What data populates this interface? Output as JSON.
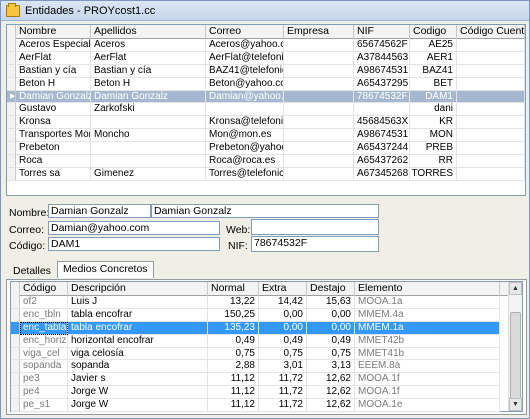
{
  "window": {
    "title": "Entidades - PROYcost1.cc",
    "icon": "folder-icon"
  },
  "entities": {
    "columns": [
      "Nombre",
      "Apellidos",
      "Correo",
      "Empresa",
      "NIF",
      "Codigo",
      "Código Cuenta"
    ],
    "rows": [
      {
        "nombre": "Aceros Especiales",
        "apellidos": "Aceros",
        "correo": "Aceros@yahoo.com",
        "empresa": "",
        "nif": "65674562F",
        "codigo": "AE25",
        "cuenta": "",
        "state": ""
      },
      {
        "nombre": "AerFlat",
        "apellidos": "AerFlat",
        "correo": "AerFlat@telefonica.e",
        "empresa": "",
        "nif": "A37844563",
        "codigo": "AER1",
        "cuenta": "",
        "state": ""
      },
      {
        "nombre": "Bastian y cía",
        "apellidos": "Bastian y cía",
        "correo": "BAZ41@telefonica.e",
        "empresa": "",
        "nif": "A98674531",
        "codigo": "BAZ41",
        "cuenta": "",
        "state": ""
      },
      {
        "nombre": "Beton H",
        "apellidos": "Beton H",
        "correo": "Beton@yahoo.com",
        "empresa": "",
        "nif": "A65437295",
        "codigo": "BET",
        "cuenta": "",
        "state": ""
      },
      {
        "nombre": "Damian Gonzalz",
        "apellidos": "Damian Gonzalz",
        "correo": "Damian@yahoo.com",
        "empresa": "",
        "nif": "78674532F",
        "codigo": "DAM1",
        "cuenta": "",
        "state": "selected"
      },
      {
        "nombre": "Gustavo",
        "apellidos": "Zarkofski",
        "correo": "",
        "empresa": "",
        "nif": "",
        "codigo": "dani",
        "cuenta": "",
        "state": ""
      },
      {
        "nombre": "Kronsa",
        "apellidos": "",
        "correo": "Kronsa@telefonica.r",
        "empresa": "",
        "nif": "45684563X",
        "codigo": "KR",
        "cuenta": "",
        "state": ""
      },
      {
        "nombre": "Transportes Mon",
        "apellidos": "Moncho",
        "correo": "Mon@mon.es",
        "empresa": "",
        "nif": "A98674531",
        "codigo": "MON",
        "cuenta": "",
        "state": ""
      },
      {
        "nombre": "Prebeton",
        "apellidos": "",
        "correo": "Prebeton@yahoo.co",
        "empresa": "",
        "nif": "A65437244",
        "codigo": "PREB",
        "cuenta": "",
        "state": ""
      },
      {
        "nombre": "Roca",
        "apellidos": "",
        "correo": "Roca@roca.es",
        "empresa": "",
        "nif": "A65437262",
        "codigo": "RR",
        "cuenta": "",
        "state": ""
      },
      {
        "nombre": "Torres sa",
        "apellidos": "Gimenez",
        "correo": "Torres@telefonica.e",
        "empresa": "",
        "nif": "A67345268",
        "codigo": "TORRES",
        "cuenta": "",
        "state": ""
      }
    ]
  },
  "form": {
    "nombre_label": "Nombre:",
    "nombre_value": "Damian Gonzalz",
    "apellidos_value": "Damian Gonzalz",
    "correo_label": "Correo:",
    "correo_value": "Damian@yahoo.com",
    "web_label": "Web:",
    "web_value": "",
    "codigo_label": "Código:",
    "codigo_value": "DAM1",
    "nif_label": "NIF:",
    "nif_value": "78674532F"
  },
  "tabs": [
    {
      "label": "Detalles",
      "active": false
    },
    {
      "label": "Medios Concretos",
      "active": true
    }
  ],
  "medios": {
    "columns": [
      "Código",
      "Descripción",
      "Normal",
      "Extra",
      "Destajo",
      "Elemento"
    ],
    "rows": [
      {
        "codigo": "of2",
        "descripcion": "Luis J",
        "normal": "13,22",
        "extra": "14,42",
        "destajo": "15,63",
        "elemento": "MOOA.1a",
        "state": "partial"
      },
      {
        "codigo": "enc_tbln",
        "descripcion": "tabla encofrar",
        "normal": "150,25",
        "extra": "0,00",
        "destajo": "0,00",
        "elemento": "MMEM.4a",
        "state": ""
      },
      {
        "codigo": "enc_tabla",
        "descripcion": "tabla encofrar",
        "normal": "135,23",
        "extra": "0,00",
        "destajo": "0,00",
        "elemento": "MMEM.1a",
        "state": "current"
      },
      {
        "codigo": "enc_horiz",
        "descripcion": "horizontal encofrar",
        "normal": "0,49",
        "extra": "0,49",
        "destajo": "0,49",
        "elemento": "MMET42b",
        "state": ""
      },
      {
        "codigo": "viga_cel",
        "descripcion": "viga celosía",
        "normal": "0,75",
        "extra": "0,75",
        "destajo": "0,75",
        "elemento": "MMET41b",
        "state": ""
      },
      {
        "codigo": "sopanda",
        "descripcion": "sopanda",
        "normal": "2,88",
        "extra": "3,01",
        "destajo": "3,13",
        "elemento": "EEEM.8a",
        "state": ""
      },
      {
        "codigo": "pe3",
        "descripcion": "Javier s",
        "normal": "11,12",
        "extra": "11,72",
        "destajo": "12,62",
        "elemento": "MOOA.1f",
        "state": ""
      },
      {
        "codigo": "pe4",
        "descripcion": "Jorge W",
        "normal": "11,12",
        "extra": "11,72",
        "destajo": "12,62",
        "elemento": "MOOA.1f",
        "state": ""
      },
      {
        "codigo": "pe_s1",
        "descripcion": "Jorge W",
        "normal": "11,12",
        "extra": "11,72",
        "destajo": "12,62",
        "elemento": "MOOA.1e",
        "state": ""
      }
    ]
  }
}
